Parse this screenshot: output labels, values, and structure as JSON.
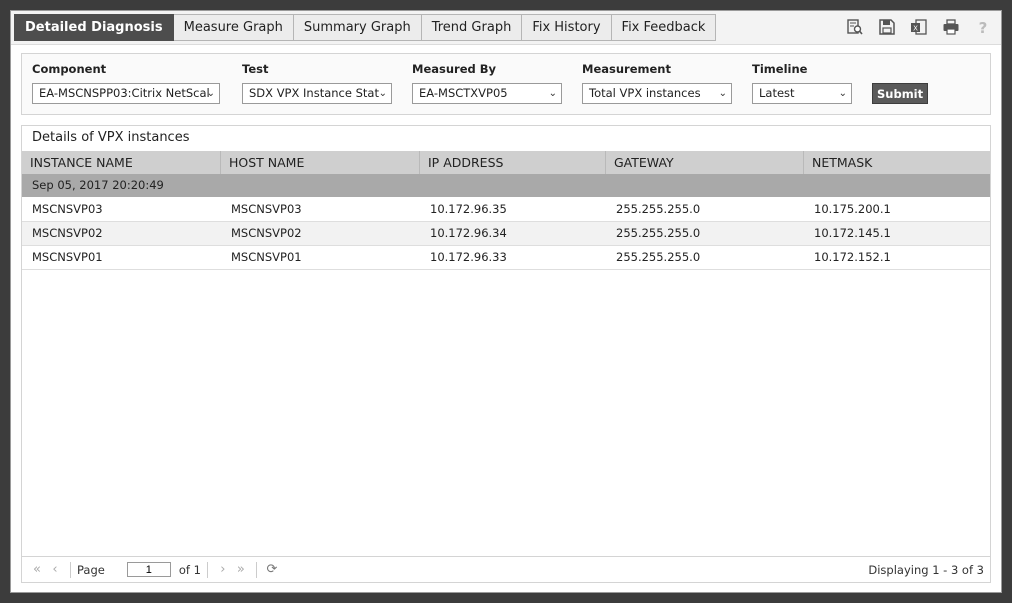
{
  "tabs": [
    {
      "label": "Detailed Diagnosis",
      "active": true
    },
    {
      "label": "Measure Graph",
      "active": false
    },
    {
      "label": "Summary Graph",
      "active": false
    },
    {
      "label": "Trend Graph",
      "active": false
    },
    {
      "label": "Fix History",
      "active": false
    },
    {
      "label": "Fix Feedback",
      "active": false
    }
  ],
  "toolbar": {
    "icons": [
      "search-report-icon",
      "save-icon",
      "excel-export-icon",
      "print-icon",
      "help-icon"
    ]
  },
  "filters": {
    "component": {
      "label": "Component",
      "value": "EA-MSCNSPP03:Citrix NetScal"
    },
    "test": {
      "label": "Test",
      "value": "SDX VPX Instance Stat"
    },
    "measured_by": {
      "label": "Measured By",
      "value": "EA-MSCTXVP05"
    },
    "measurement": {
      "label": "Measurement",
      "value": "Total VPX instances"
    },
    "timeline": {
      "label": "Timeline",
      "value": "Latest"
    },
    "submit_label": "Submit"
  },
  "grid": {
    "title": "Details of VPX instances",
    "columns": [
      "INSTANCE NAME",
      "HOST NAME",
      "IP ADDRESS",
      "GATEWAY",
      "NETMASK"
    ],
    "group_label": "Sep 05, 2017 20:20:49",
    "rows": [
      [
        "MSCNSVP03",
        "MSCNSVP03",
        "10.172.96.35",
        "255.255.255.0",
        "10.175.200.1"
      ],
      [
        "MSCNSVP02",
        "MSCNSVP02",
        "10.172.96.34",
        "255.255.255.0",
        "10.172.145.1"
      ],
      [
        "MSCNSVP01",
        "MSCNSVP01",
        "10.172.96.33",
        "255.255.255.0",
        "10.172.152.1"
      ]
    ]
  },
  "pager": {
    "page_label": "Page",
    "page_value": "1",
    "of_label": "of 1",
    "display_text": "Displaying 1 - 3 of 3"
  }
}
